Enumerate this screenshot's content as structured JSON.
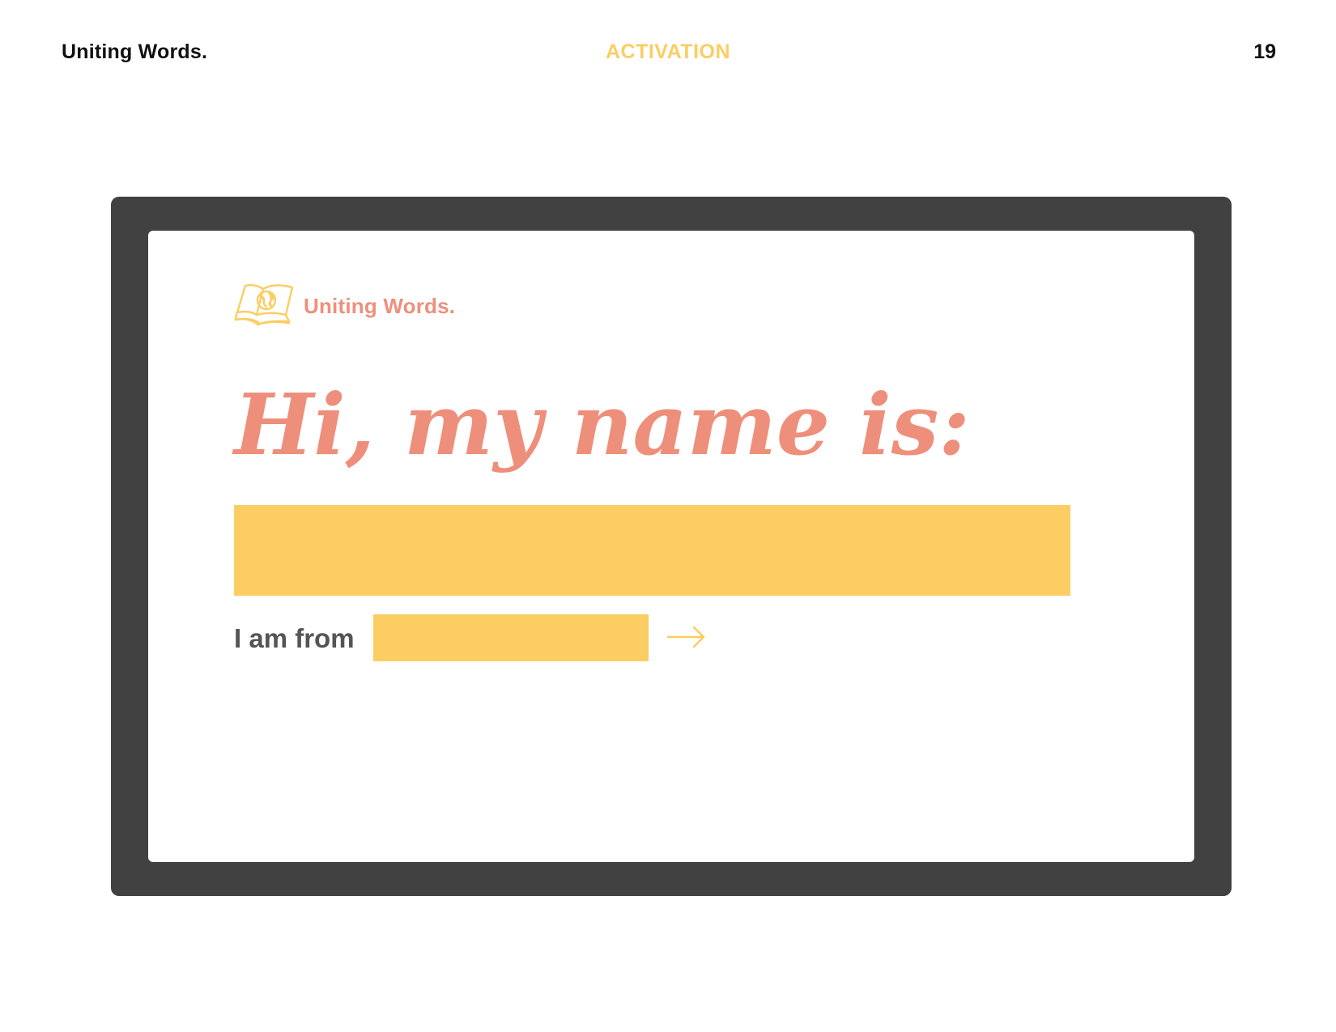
{
  "header": {
    "brand": "Uniting Words.",
    "section": "ACTIVATION",
    "page_number": "19"
  },
  "colors": {
    "accent_yellow": "#FBCD63",
    "accent_salmon": "#EE8F7B",
    "device_frame": "#414141",
    "text_dark": "#111111",
    "text_gray": "#555555"
  },
  "screen": {
    "logo_icon": "open-book-globe-icon",
    "logo_text": "Uniting Words.",
    "greeting": "Hi, my name is:",
    "name_input_value": "",
    "from_label": "I am from",
    "from_input_value": "",
    "next_icon": "arrow-right-icon"
  }
}
